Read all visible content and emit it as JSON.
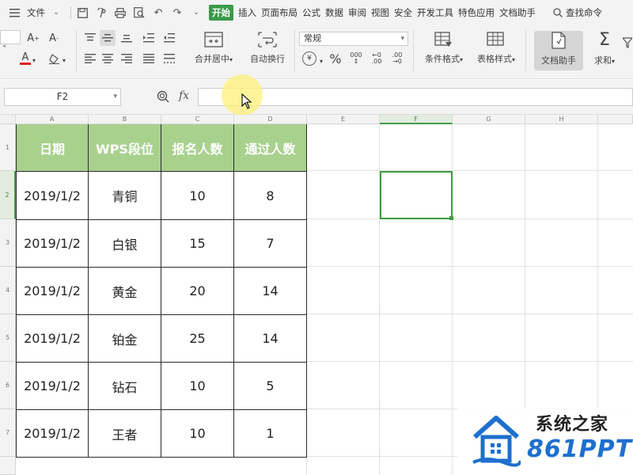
{
  "menu": {
    "file_label": "文件",
    "tabs": [
      "开始",
      "插入",
      "页面布局",
      "公式",
      "数据",
      "审阅",
      "视图",
      "安全",
      "开发工具",
      "特色应用",
      "文档助手"
    ],
    "active_tab": "开始",
    "search_label": "查找命令"
  },
  "ribbon": {
    "merge_label": "合并居中",
    "wrap_label": "自动换行",
    "number_format": "常规",
    "cond_format_label": "条件格式",
    "table_style_label": "表格样式",
    "doc_assist_label": "文档助手",
    "sum_label": "求和",
    "percent_symbol": "%",
    "yen_symbol": "¥"
  },
  "formula_bar": {
    "name_box": "F2",
    "fx_label": "fx",
    "formula": ""
  },
  "sheet": {
    "columns": [
      "A",
      "B",
      "C",
      "D",
      "E",
      "F",
      "G",
      "H"
    ],
    "rows": [
      "1",
      "2",
      "3",
      "4",
      "5",
      "6",
      "7"
    ],
    "selected_column": "F",
    "selected_row": "2",
    "headers": [
      "日期",
      "WPS段位",
      "报名人数",
      "通过人数"
    ],
    "data": [
      [
        "2019/1/2",
        "青铜",
        "10",
        "8"
      ],
      [
        "2019/1/2",
        "白银",
        "15",
        "7"
      ],
      [
        "2019/1/2",
        "黄金",
        "20",
        "14"
      ],
      [
        "2019/1/2",
        "铂金",
        "25",
        "14"
      ],
      [
        "2019/1/2",
        "钻石",
        "10",
        "5"
      ],
      [
        "2019/1/2",
        "王者",
        "10",
        "1"
      ]
    ]
  },
  "colors": {
    "accent": "#3a9a4a",
    "header_fill": "#a9d18e"
  },
  "watermark": {
    "title": "系统之家",
    "subtitle": "861PPT"
  }
}
